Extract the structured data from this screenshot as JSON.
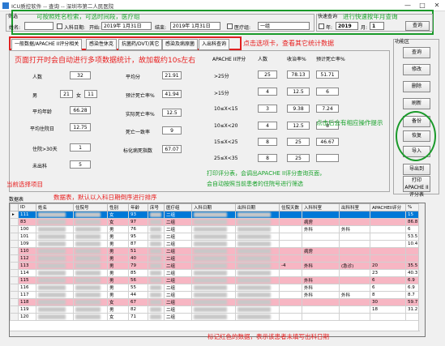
{
  "window": {
    "title": "ICU质控软件 -- 查询 -- 深圳市第二人民医院",
    "min": "—",
    "max": "□",
    "close": "✕"
  },
  "filter": {
    "group_label": "筛选",
    "hint": "可按照姓名检索，可选时间段，医疗组",
    "name_label": "姓名:",
    "name_value": "",
    "date_check_label": "入科日期:",
    "start_label": "开始:",
    "start_value": "2019年 1月31日",
    "end_label": "结束:",
    "end_value": "2019年 1月31日",
    "med_group_label": "医疗组:",
    "med_group_value": "一组"
  },
  "quick": {
    "group_label": "快速查询",
    "hint": "进行快速按年月查询",
    "year_label": "年:",
    "year_value": "2019",
    "month_label": "月:",
    "month_value": "1",
    "query_btn": "查询"
  },
  "tabs": [
    {
      "label": "一般数据/APACHE II评分相关"
    },
    {
      "label": "感染性休克"
    },
    {
      "label": "抗菌药/DVT/其它"
    },
    {
      "label": "感染及病原菌"
    },
    {
      "label": "入出科查询"
    }
  ],
  "tab_hint": "点击选项卡，查看其它统计数据",
  "auto_hint": "页面打开时会自动进行多项数据统计，故加载约10s左右",
  "stats_left": {
    "count_label": "人数",
    "count_value": "32",
    "male_label": "男",
    "male_value": "21",
    "female_label": "女",
    "female_value": "11",
    "avg_age_label": "平均年龄",
    "avg_age_value": "66.28",
    "avg_stay_label": "平均住院日",
    "avg_stay_value": "12.75",
    "readmit_label": "住院>30天",
    "readmit_value": "1",
    "discharged_label": "未出科",
    "discharged_value": "5"
  },
  "stats_mid": {
    "avg_score_label": "平均分",
    "avg_score_value": "21.91",
    "pred_death_label": "预计死亡率%",
    "pred_death_value": "41.94",
    "actual_death_label": "实际死亡率%",
    "actual_death_value": "12.5",
    "death_count_label": "死亡一致率",
    "death_count_value": "9",
    "std_ratio_label": "标化病死指数",
    "std_ratio_value": "67.07"
  },
  "apache_table": {
    "headers": [
      "APACHE II评分",
      "人数",
      "收治率%",
      "预计死亡率%"
    ],
    "rows": [
      {
        "range": ">25分",
        "n": "25",
        "rate": "78.13",
        "pred": "51.71"
      },
      {
        "range": ">15分",
        "n": "4",
        "rate": "12.5",
        "pred": "6"
      },
      {
        "range": "10≤X<15",
        "n": "3",
        "rate": "9.38",
        "pred": "7.24"
      },
      {
        "range": "10≤X<20",
        "n": "4",
        "rate": "12.5",
        "pred": "8"
      },
      {
        "range": "15≤X<25",
        "n": "8",
        "rate": "25",
        "pred": "46.67"
      },
      {
        "range": "25≤X<35",
        "n": "8",
        "rate": "25",
        "pred": ""
      }
    ]
  },
  "side": {
    "group_label": "功能区",
    "buttons": [
      "查询",
      "修改",
      "删除",
      "刷新",
      "备份",
      "恢复",
      "导入",
      "导出到EXCEL",
      "打印APACHE II评分表"
    ],
    "ops_hint": "点击后会有相应操作提示",
    "print_hint1": "打印评分表，会调出APACHE II评分查询页面，",
    "print_hint2": "会自动按照当前患者的住院号进行筛选"
  },
  "grid": {
    "group_label": "数据表",
    "cur_hint": "当前选择项目",
    "sort_hint": "数据表，默认以入科日期倒序进行排序",
    "pink_hint": "标记红色的数据，表示该患者未填写出科日期",
    "columns": [
      "ID",
      "姓名",
      "住院号",
      "性别",
      "年龄",
      "床号",
      "医疗组",
      "入科日期",
      "出科日期",
      "住院天数",
      "入科科室",
      "出科科室",
      "APACHEII评分",
      "%"
    ],
    "rows": [
      {
        "id": "111",
        "sex": "女",
        "age": "93",
        "grp": "二组",
        "days": "",
        "dept1": "",
        "dept2": "",
        "score": "",
        "pct": "15",
        "style": "sel"
      },
      {
        "id": "83",
        "sex": "女",
        "age": "97",
        "grp": "二组",
        "days": "",
        "dept1": "病房",
        "dept2": "",
        "score": "",
        "pct": "86.8",
        "style": "pink"
      },
      {
        "id": "100",
        "sex": "男",
        "age": "76",
        "grp": "二组",
        "days": "",
        "dept1": "外科",
        "dept2": "外科",
        "score": "",
        "pct": "6",
        "style": ""
      },
      {
        "id": "101",
        "sex": "男",
        "age": "95",
        "grp": "二组",
        "days": "",
        "dept1": "",
        "dept2": "",
        "score": "",
        "pct": "53.5",
        "style": ""
      },
      {
        "id": "109",
        "sex": "男",
        "age": "87",
        "grp": "二组",
        "days": "",
        "dept1": "",
        "dept2": "",
        "score": "",
        "pct": "10.4",
        "style": ""
      },
      {
        "id": "110",
        "sex": "男",
        "age": "51",
        "grp": "二组",
        "days": "",
        "dept1": "病房",
        "dept2": "",
        "score": "",
        "pct": "",
        "style": "pink"
      },
      {
        "id": "112",
        "sex": "男",
        "age": "40",
        "grp": "二组",
        "days": "",
        "dept1": "",
        "dept2": "",
        "score": "",
        "pct": "",
        "style": "pink"
      },
      {
        "id": "113",
        "sex": "男",
        "age": "79",
        "grp": "二组",
        "days": "-4",
        "dept1": "外科",
        "dept2": "(急诊)",
        "score": "20",
        "pct": "35.5",
        "style": "pink"
      },
      {
        "id": "114",
        "sex": "男",
        "age": "85",
        "grp": "二组",
        "days": "",
        "dept1": "",
        "dept2": "",
        "score": "23",
        "pct": "40.3",
        "style": ""
      },
      {
        "id": "115",
        "sex": "男",
        "age": "56",
        "grp": "二组",
        "days": "",
        "dept1": "外科",
        "dept2": "",
        "score": "6",
        "pct": "6.9",
        "style": "pink"
      },
      {
        "id": "116",
        "sex": "男",
        "age": "55",
        "grp": "二组",
        "days": "",
        "dept1": "外科",
        "dept2": "",
        "score": "6",
        "pct": "6.9",
        "style": ""
      },
      {
        "id": "117",
        "sex": "男",
        "age": "44",
        "grp": "二组",
        "days": "",
        "dept1": "外科",
        "dept2": "外科",
        "score": "8",
        "pct": "8.7",
        "style": ""
      },
      {
        "id": "118",
        "sex": "女",
        "age": "67",
        "grp": "二组",
        "days": "",
        "dept1": "",
        "dept2": "",
        "score": "30",
        "pct": "59.7",
        "style": "pink"
      },
      {
        "id": "119",
        "sex": "男",
        "age": "82",
        "grp": "二组",
        "days": "",
        "dept1": "",
        "dept2": "",
        "score": "18",
        "pct": "31.2",
        "style": ""
      },
      {
        "id": "120",
        "sex": "女",
        "age": "71",
        "grp": "二组",
        "days": "",
        "dept1": "",
        "dept2": "",
        "score": "",
        "pct": "",
        "style": ""
      }
    ]
  }
}
